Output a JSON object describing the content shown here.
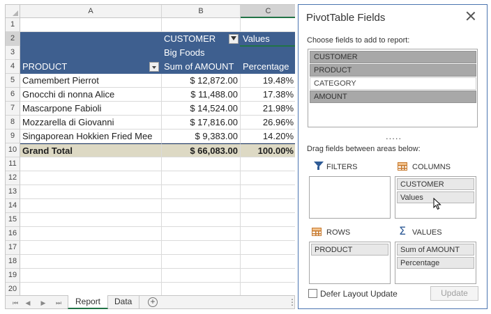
{
  "sheet": {
    "columns": [
      "A",
      "B",
      "C"
    ],
    "rows": [
      "1",
      "2",
      "3",
      "4",
      "5",
      "6",
      "7",
      "8",
      "9",
      "10",
      "11",
      "12",
      "13",
      "14",
      "15",
      "16",
      "17",
      "18",
      "19",
      "20"
    ],
    "pivot_header": {
      "customer_label": "CUSTOMER",
      "values_label": "Values",
      "customer_value": "Big Foods",
      "product_label": "PRODUCT",
      "sum_label": "Sum of AMOUNT",
      "percentage_label": "Percentage"
    },
    "data_rows": [
      {
        "product": "Camembert Pierrot",
        "amount": "$ 12,872.00",
        "percentage": "19.48%"
      },
      {
        "product": "Gnocchi di nonna Alice",
        "amount": "$ 11,488.00",
        "percentage": "17.38%"
      },
      {
        "product": "Mascarpone Fabioli",
        "amount": "$ 14,524.00",
        "percentage": "21.98%"
      },
      {
        "product": "Mozzarella di Giovanni",
        "amount": "$ 17,816.00",
        "percentage": "26.96%"
      },
      {
        "product": "Singaporean Hokkien Fried Mee",
        "amount": "$ 9,383.00",
        "percentage": "14.20%"
      }
    ],
    "grand_total": {
      "label": "Grand Total",
      "amount": "$ 66,083.00",
      "percentage": "100.00%"
    }
  },
  "tabs": {
    "nav_first": "⏮",
    "nav_prev": "◀",
    "nav_next": "▶",
    "nav_last": "⏭",
    "items": [
      {
        "label": "Report",
        "active": true
      },
      {
        "label": "Data",
        "active": false
      }
    ],
    "add_label": "+"
  },
  "panel": {
    "title": "PivotTable Fields",
    "choose_label": "Choose fields to add to report:",
    "fields": [
      {
        "label": "CUSTOMER",
        "checked": true
      },
      {
        "label": "PRODUCT",
        "checked": true
      },
      {
        "label": "CATEGORY",
        "checked": false
      },
      {
        "label": "AMOUNT",
        "checked": true
      }
    ],
    "splitter": ".....",
    "drag_label": "Drag fields between areas below:",
    "areas": {
      "filters": {
        "label": "FILTERS",
        "items": []
      },
      "columns": {
        "label": "COLUMNS",
        "items": [
          "CUSTOMER",
          "Values"
        ]
      },
      "rows": {
        "label": "ROWS",
        "items": [
          "PRODUCT"
        ]
      },
      "values": {
        "label": "VALUES",
        "items": [
          "Sum of AMOUNT",
          "Percentage"
        ]
      }
    },
    "defer_label": "Defer Layout Update",
    "update_label": "Update",
    "sigma": "Σ"
  },
  "colors": {
    "pivot_header_bg": "#3e5f8f",
    "grand_total_bg": "#ddd9c4",
    "selection": "#217346",
    "panel_border": "#4a74b0"
  }
}
